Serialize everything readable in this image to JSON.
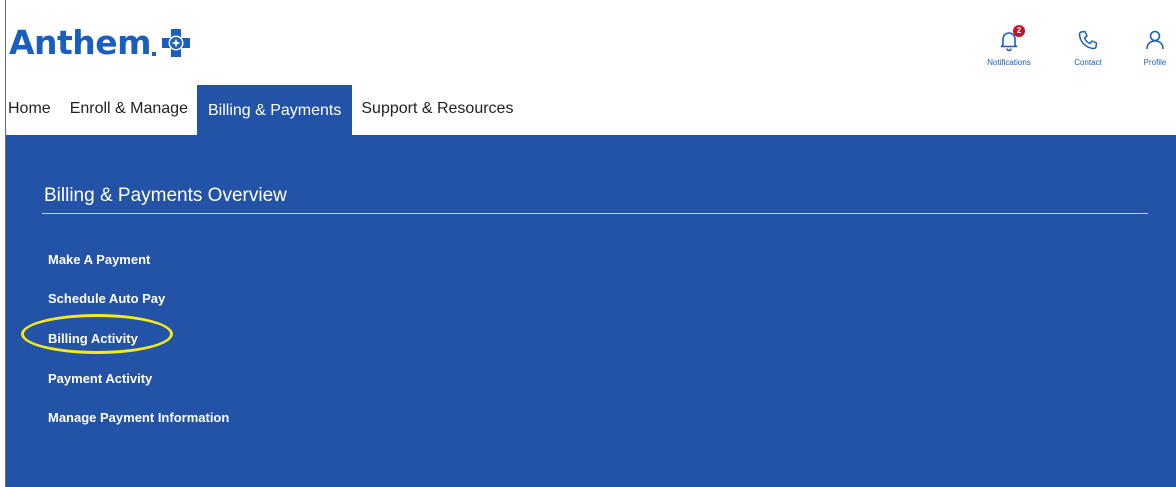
{
  "brand": {
    "name": "Anthem",
    "blue": "#1a5fc0",
    "panel_blue": "#2353a6",
    "badge_red": "#c8102e",
    "highlight_yellow": "#f5ea1a"
  },
  "utility": {
    "notifications": {
      "label": "Notifications",
      "count": "2",
      "icon": "bell-icon"
    },
    "contact": {
      "label": "Contact",
      "icon": "phone-icon"
    },
    "profile": {
      "label": "Profile",
      "icon": "person-icon"
    }
  },
  "nav": {
    "tabs": [
      {
        "label": "Home",
        "active": false
      },
      {
        "label": "Enroll & Manage",
        "active": false
      },
      {
        "label": "Billing & Payments",
        "active": true
      },
      {
        "label": "Support & Resources",
        "active": false
      }
    ]
  },
  "panel": {
    "title": "Billing & Payments Overview",
    "links": [
      {
        "label": "Make A Payment"
      },
      {
        "label": "Schedule Auto Pay"
      },
      {
        "label": "Billing Activity",
        "highlighted": true
      },
      {
        "label": "Payment Activity"
      },
      {
        "label": "Manage Payment Information"
      }
    ]
  }
}
